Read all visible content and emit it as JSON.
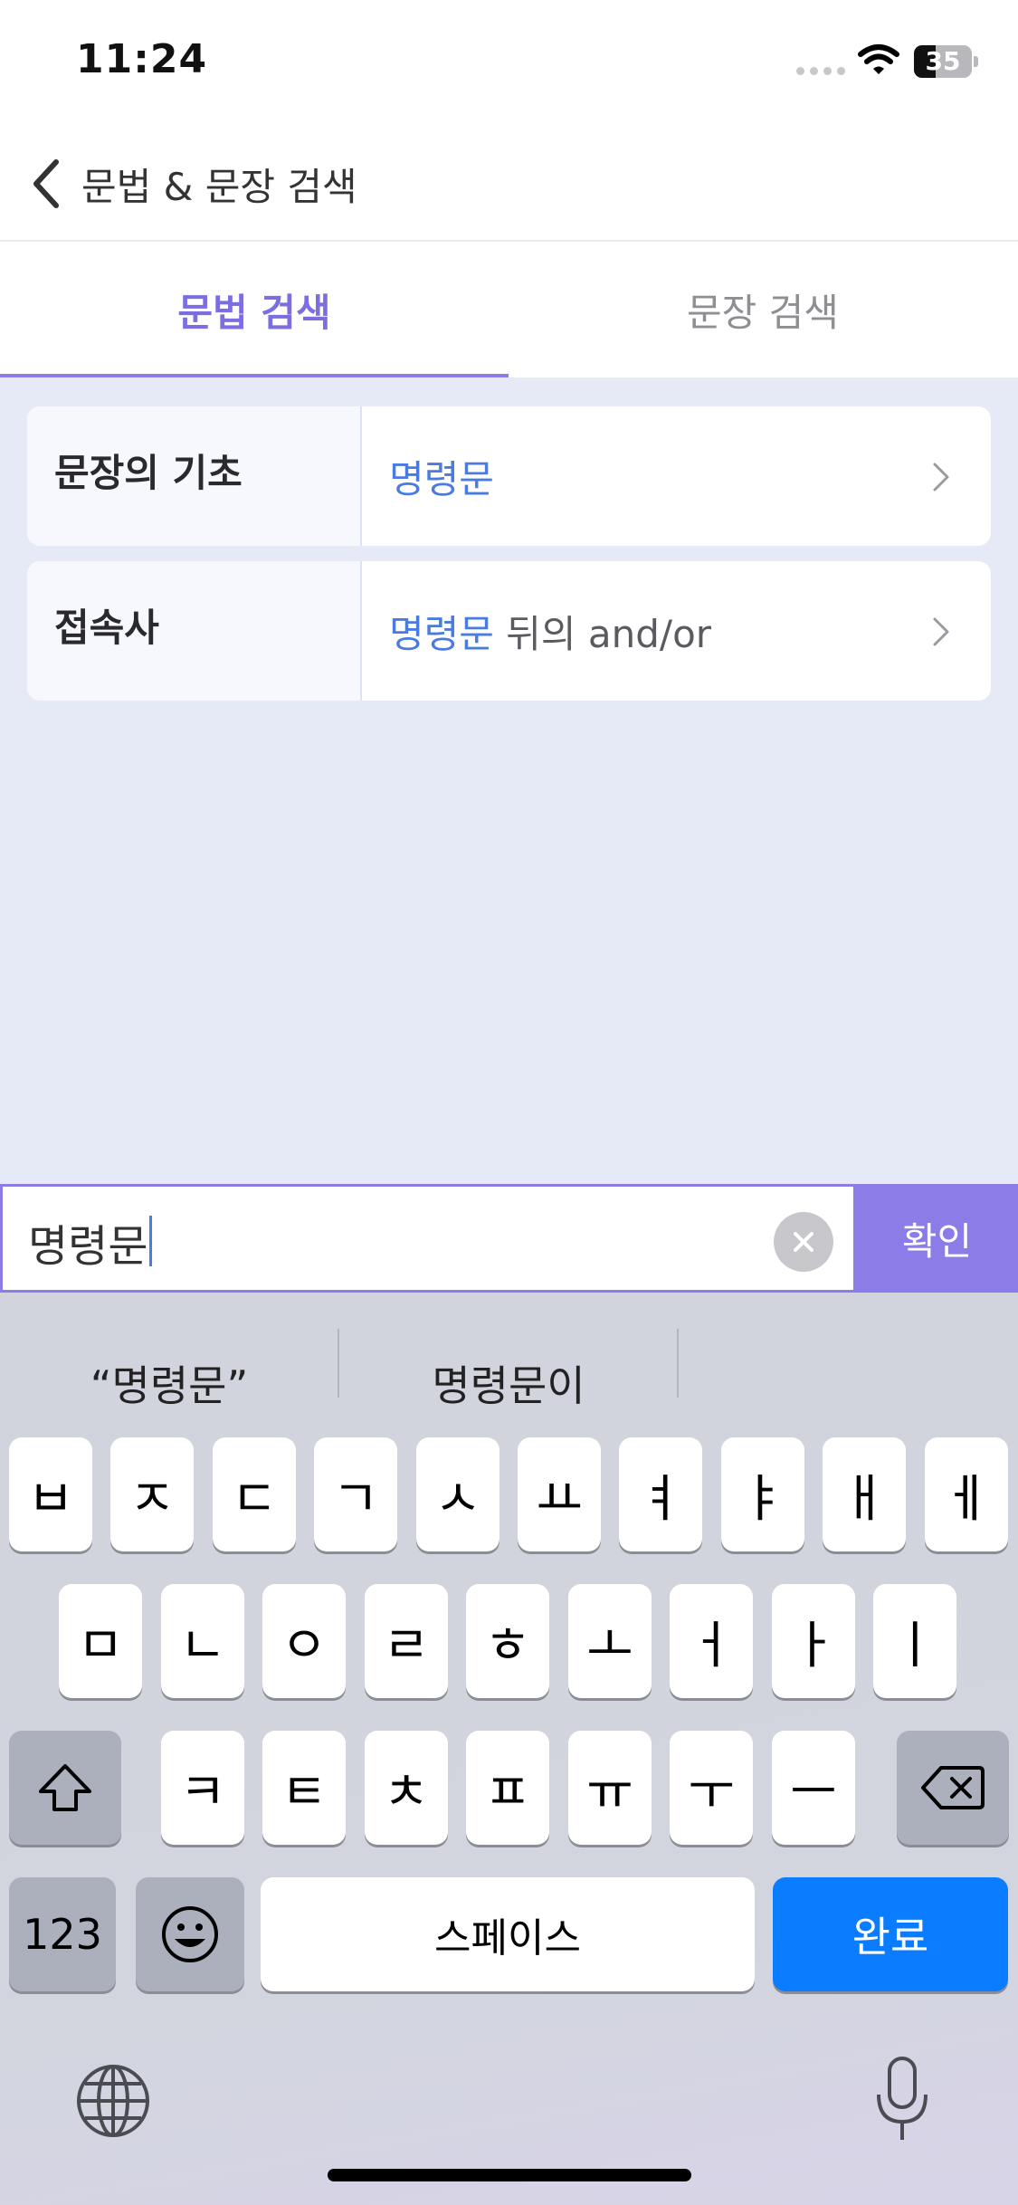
{
  "status_bar": {
    "time": "11:24",
    "battery_level": "35"
  },
  "nav": {
    "title": "문법 & 문장 검색"
  },
  "tabs": [
    {
      "label": "문법 검색",
      "active": true
    },
    {
      "label": "문장 검색",
      "active": false
    }
  ],
  "results": [
    {
      "category": "문장의 기초",
      "highlight": "명령문",
      "rest": ""
    },
    {
      "category": "접속사",
      "highlight": "명령문",
      "rest": " 뒤의 and/or"
    }
  ],
  "search": {
    "value": "명령문",
    "confirm_label": "확인"
  },
  "keyboard": {
    "suggestions": [
      "“명령문”",
      "명령문이",
      ""
    ],
    "row1": [
      "ㅂ",
      "ㅈ",
      "ㄷ",
      "ㄱ",
      "ㅅ",
      "ㅛ",
      "ㅕ",
      "ㅑ",
      "ㅐ",
      "ㅔ"
    ],
    "row2": [
      "ㅁ",
      "ㄴ",
      "ㅇ",
      "ㄹ",
      "ㅎ",
      "ㅗ",
      "ㅓ",
      "ㅏ",
      "ㅣ"
    ],
    "row3": [
      "ㅋ",
      "ㅌ",
      "ㅊ",
      "ㅍ",
      "ㅠ",
      "ㅜ",
      "ㅡ"
    ],
    "num_label": "123",
    "space_label": "스페이스",
    "done_label": "완료"
  },
  "colors": {
    "accent": "#8b7ce8",
    "highlight_text": "#4a7be0",
    "done_key": "#0a7cff",
    "background": "#e6e9f6"
  }
}
